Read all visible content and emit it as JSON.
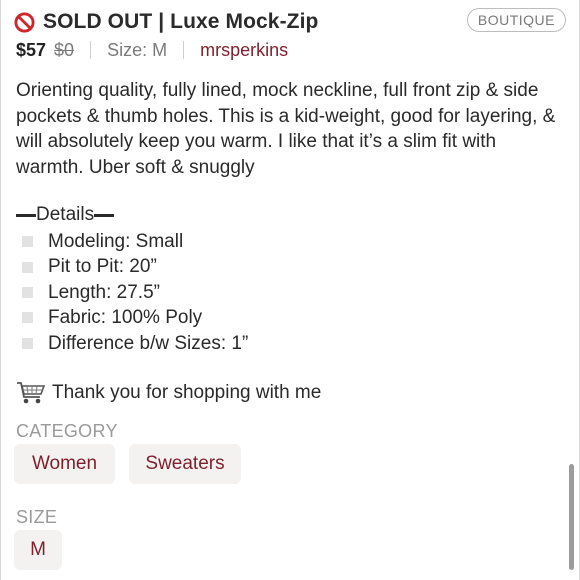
{
  "listing": {
    "status": "SOLD OUT",
    "title": "SOLD OUT | Luxe Mock-Zip",
    "badge": "BOUTIQUE",
    "price": "$57",
    "original_price": "$0",
    "size_inline": "Size: M",
    "seller": "mrsperkins"
  },
  "description": "Orienting quality, fully lined, mock neckline, full front zip & side pockets & thumb holes. This is a kid-weight, good for layering, & will absolutely keep you warm. I like that it’s a slim fit with warmth. Uber soft & snuggly",
  "details": {
    "heading": "Details",
    "items": [
      "Modeling: Small",
      "Pit to Pit: 20”",
      "Length: 27.5”",
      "Fabric: 100% Poly",
      "Difference b/w Sizes: 1”"
    ]
  },
  "thanks": "Thank you for shopping with me",
  "category": {
    "label": "CATEGORY",
    "chips": [
      "Women",
      "Sweaters"
    ]
  },
  "size": {
    "label": "SIZE",
    "chip": "M"
  },
  "icons": {
    "status": "prohibited-icon",
    "thanks": "shopping-cart-icon"
  },
  "colors": {
    "accent": "#7f1f2d",
    "prohibited": "#d0262b",
    "muted": "#9a9a9a",
    "chip_bg": "#f3f2f0"
  }
}
